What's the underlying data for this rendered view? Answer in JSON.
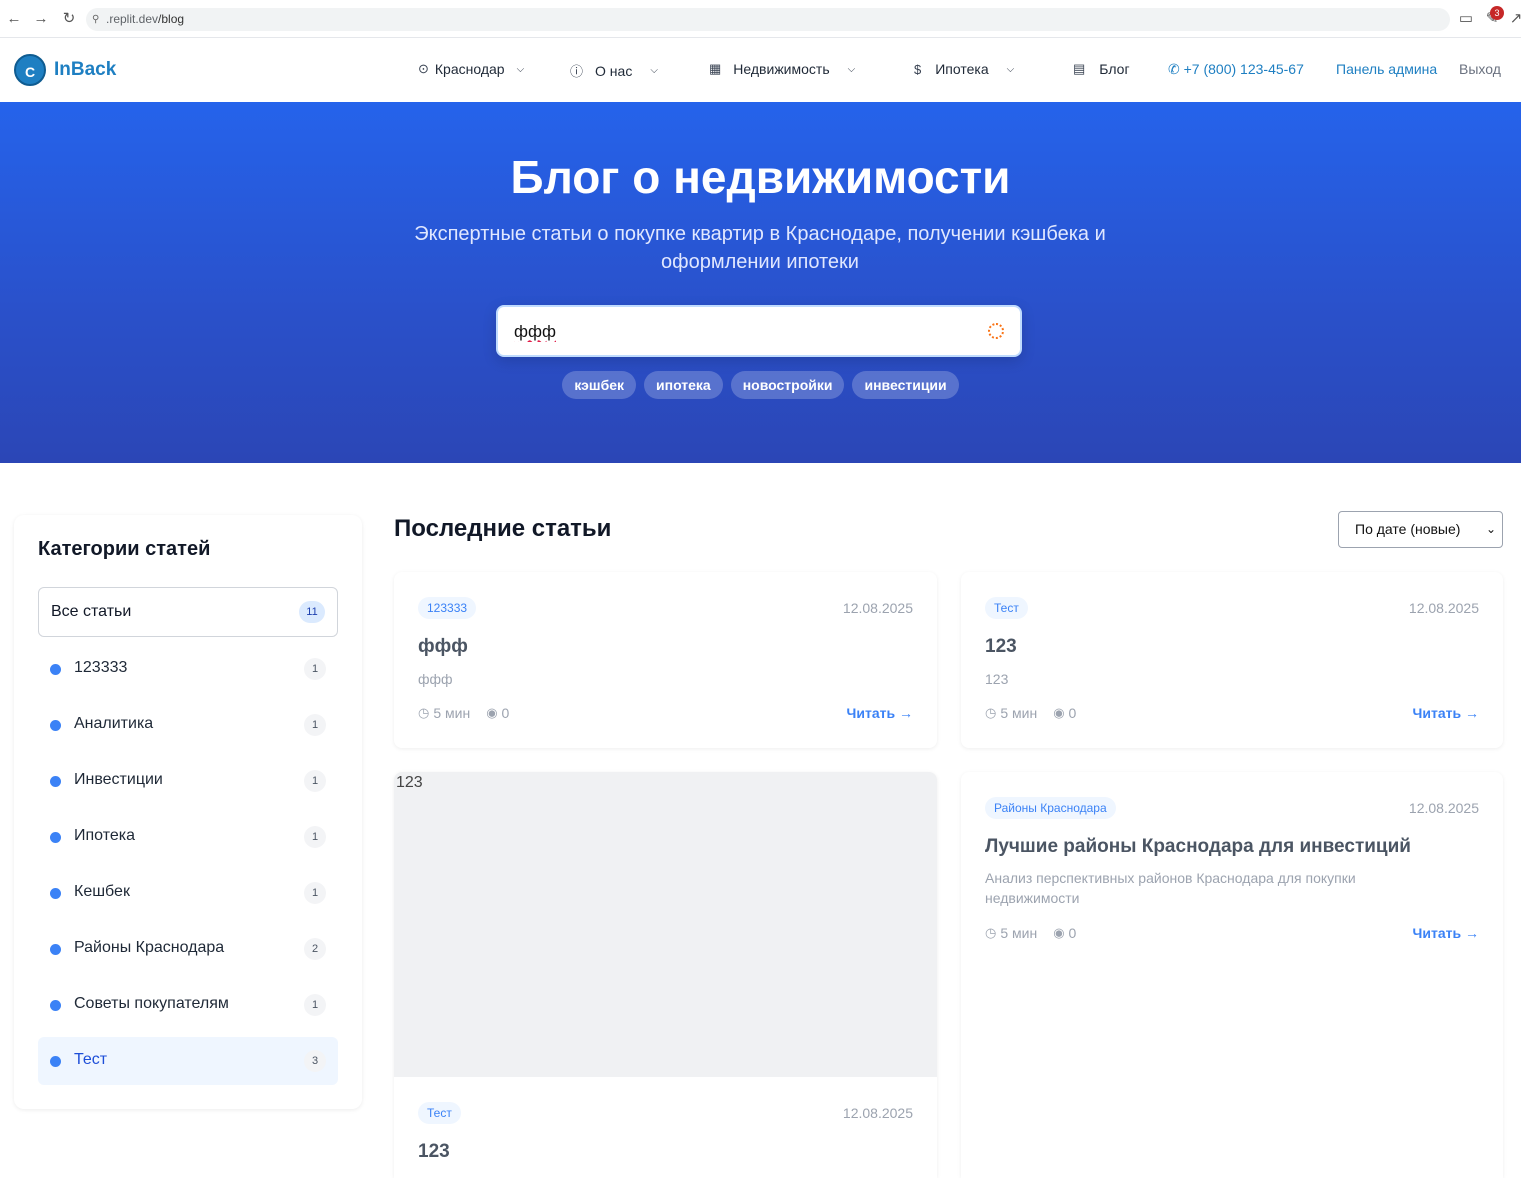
{
  "browser": {
    "url_host": ".replit.dev",
    "url_path": "/blog",
    "badge_count": "3"
  },
  "header": {
    "logo_letter": "C",
    "logo_text": "InBack",
    "nav": {
      "city": "Краснодар",
      "about": "О нас",
      "realty": "Недвижимость",
      "mortgage": "Ипотека",
      "blog": "Блог"
    },
    "phone": "+7 (800) 123-45-67",
    "admin": "Панель админа",
    "logout": "Выход"
  },
  "hero": {
    "title": "Блог о недвижимости",
    "subtitle": "Экспертные статьи о покупке квартир в Краснодаре, получении кэшбека и оформлении ипотеки",
    "search_value": "ффф",
    "tags": [
      "кэшбек",
      "ипотека",
      "новостройки",
      "инвестиции"
    ]
  },
  "sidebar": {
    "title": "Категории статей",
    "all": {
      "label": "Все статьи",
      "count": "11"
    },
    "items": [
      {
        "label": "123333",
        "count": "1"
      },
      {
        "label": "Аналитика",
        "count": "1"
      },
      {
        "label": "Инвестиции",
        "count": "1"
      },
      {
        "label": "Ипотека",
        "count": "1"
      },
      {
        "label": "Кешбек",
        "count": "1"
      },
      {
        "label": "Районы Краснодара",
        "count": "2"
      },
      {
        "label": "Советы покупателям",
        "count": "1"
      },
      {
        "label": "Тест",
        "count": "3"
      }
    ]
  },
  "main": {
    "title": "Последние статьи",
    "sort": "По дате (новые)",
    "read_label": "Читать →",
    "cards": [
      {
        "category": "123333",
        "date": "12.08.2025",
        "title": "ффф",
        "excerpt": "ффф",
        "time": "5 мин",
        "views": "0"
      },
      {
        "category": "Тест",
        "date": "12.08.2025",
        "title": "123",
        "excerpt": "123",
        "time": "5 мин",
        "views": "0"
      },
      {
        "image_alt": "123",
        "category": "Тест",
        "date": "12.08.2025",
        "title": "123"
      },
      {
        "category": "Районы Краснодара",
        "date": "12.08.2025",
        "title": "Лучшие районы Краснодара для инвестиций",
        "excerpt": "Анализ перспективных районов Краснодара для покупки недвижимости",
        "time": "5 мин",
        "views": "0"
      }
    ]
  }
}
